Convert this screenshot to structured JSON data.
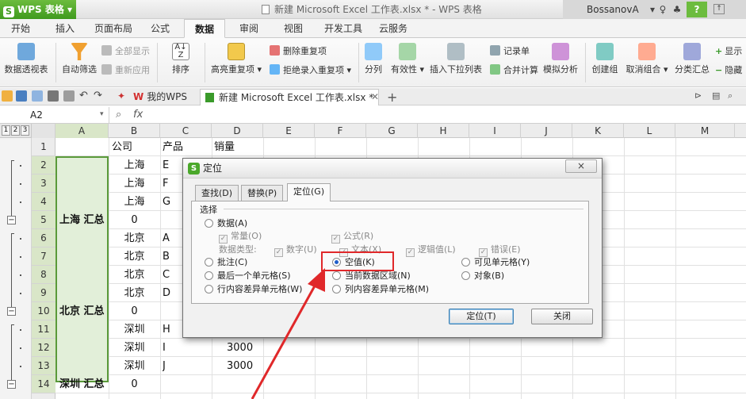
{
  "titlebar": {
    "app_name": "WPS 表格",
    "window_title": "新建 Microsoft Excel 工作表.xlsx * - WPS 表格",
    "user": "BossanovA",
    "help": "?"
  },
  "ribbon_tabs": [
    "开始",
    "插入",
    "页面布局",
    "公式",
    "数据",
    "审阅",
    "视图",
    "开发工具",
    "云服务"
  ],
  "active_tab": "数据",
  "ribbon": {
    "pivot": "数据透视表",
    "autofilter": "自动筛选",
    "show_all": "全部显示",
    "reapply": "重新应用",
    "sort": "排序",
    "highlight_dup": "高亮重复项",
    "delete_dup": "删除重复项",
    "reject_dup": "拒绝录入重复项",
    "text_to_cols": "分列",
    "validity": "有效性",
    "dropdown": "插入下拉列表",
    "record_list": "记录单",
    "consolidate": "合并计算",
    "what_if": "模拟分析",
    "group": "创建组",
    "ungroup": "取消组合",
    "subtotal": "分类汇总",
    "show_detail": "显示",
    "hide_detail": "隐藏"
  },
  "doc_tabs": {
    "home": "我的WPS",
    "file": "新建 Microsoft Excel 工作表.xlsx *"
  },
  "formula_bar": {
    "cell_ref": "A2",
    "fx": "fx"
  },
  "outline_levels": [
    "1",
    "2",
    "3"
  ],
  "columns": [
    "A",
    "B",
    "C",
    "D",
    "E",
    "F",
    "G",
    "H",
    "I",
    "J",
    "K",
    "L",
    "M"
  ],
  "row_numbers": [
    "1",
    "2",
    "3",
    "4",
    "5",
    "6",
    "7",
    "8",
    "9",
    "10",
    "11",
    "12",
    "13",
    "14"
  ],
  "cells": {
    "r1": {
      "b": "公司",
      "c": "产品",
      "d": "销量"
    },
    "r2": {
      "b": "上海",
      "c": "E"
    },
    "r3": {
      "b": "上海",
      "c": "F"
    },
    "r4": {
      "b": "上海",
      "c": "G"
    },
    "r5": {
      "a": "上海 汇总",
      "b": "0"
    },
    "r6": {
      "b": "北京",
      "c": "A"
    },
    "r7": {
      "b": "北京",
      "c": "B"
    },
    "r8": {
      "b": "北京",
      "c": "C"
    },
    "r9": {
      "b": "北京",
      "c": "D"
    },
    "r10": {
      "a": "北京 汇总",
      "b": "0"
    },
    "r11": {
      "b": "深圳",
      "c": "H"
    },
    "r12": {
      "b": "深圳",
      "c": "I",
      "d": "3000"
    },
    "r13": {
      "b": "深圳",
      "c": "J",
      "d": "3000"
    },
    "r14": {
      "a": "深圳 汇总",
      "b": "0"
    }
  },
  "dialog": {
    "title": "定位",
    "close": "×",
    "tabs": [
      "查找(D)",
      "替换(P)",
      "定位(G)"
    ],
    "group": "选择",
    "opt_data": "数据(A)",
    "opt_constant": "常量(O)",
    "opt_formula": "公式(R)",
    "datatype_label": "数据类型:",
    "opt_number": "数字(U)",
    "opt_text": "文本(X)",
    "opt_logic": "逻辑值(L)",
    "opt_error": "错误(E)",
    "opt_comment": "批注(C)",
    "opt_blank": "空值(K)",
    "opt_visible": "可见单元格(Y)",
    "opt_last": "最后一个单元格(S)",
    "opt_region": "当前数据区域(N)",
    "opt_object": "对象(B)",
    "opt_rowdiff": "行内容差异单元格(W)",
    "opt_coldiff": "列内容差异单元格(M)",
    "btn_locate": "定位(T)",
    "btn_close": "关闭"
  },
  "colors": {
    "green": "#4aa82a",
    "selection": "#e2efd9",
    "highlight": "#e0282a"
  }
}
